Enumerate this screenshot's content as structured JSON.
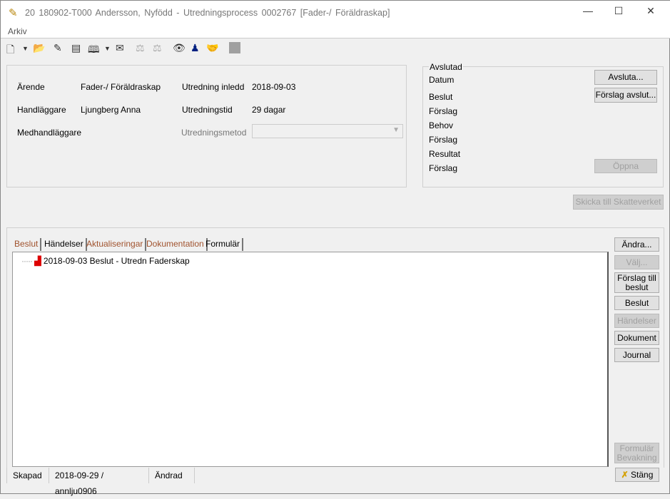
{
  "window": {
    "title": "20 180902-T000   Andersson, Nyfödd   -   Utredningsprocess   0002767   [Fader-/ Föräldraskap]",
    "menu": [
      "Arkiv"
    ]
  },
  "toolbar": {
    "icons": [
      "new-document-icon",
      "dropdown-icon",
      "open-folder-icon",
      "edit-icon",
      "document-icon",
      "book-icon",
      "dropdown-icon",
      "mail-icon",
      "scale-icon",
      "scale-icon",
      "eye-icon",
      "person-icon",
      "handshake-icon",
      "gray-box-icon"
    ]
  },
  "info": {
    "arende_label": "Ärende",
    "arende_value": "Fader-/ Föräldraskap",
    "handlaggare_label": "Handläggare",
    "handlaggare_value": "Ljungberg Anna",
    "medhandlaggare_label": "Medhandläggare",
    "inledd_label": "Utredning inledd",
    "inledd_value": "2018-09-03",
    "tid_label": "Utredningstid",
    "tid_value": "29 dagar",
    "metod_label": "Utredningsmetod",
    "metod_value": ""
  },
  "avslutad": {
    "title": "Avslutad",
    "rows": [
      "Datum",
      "Beslut",
      "Förslag",
      "Behov",
      "Förslag",
      "Resultat",
      "Förslag"
    ],
    "avsluta": "Avsluta...",
    "forslag_avslut": "Förslag avslut...",
    "oppna": "Öppna"
  },
  "skicka": "Skicka till Skatteverket",
  "tabs": [
    "Beslut",
    "Händelser",
    "Aktualiseringar",
    "Dokumentation",
    "Formulär"
  ],
  "tree": [
    {
      "date": "2018-09-03",
      "text": "Beslut - Utredn Faderskap"
    }
  ],
  "side_buttons": {
    "andra": "Ändra...",
    "valj": "Välj...",
    "forslag1": "Förslag till",
    "forslag2": "beslut",
    "beslut": "Beslut",
    "handelser": "Händelser",
    "dokument": "Dokument",
    "journal": "Journal",
    "formular1": "Formulär",
    "formular2": "Bevakning"
  },
  "status": {
    "skapad_label": "Skapad",
    "skapad_value": "2018-09-29 / annlju0906",
    "andrad_label": "Ändrad"
  },
  "close": "Stäng"
}
